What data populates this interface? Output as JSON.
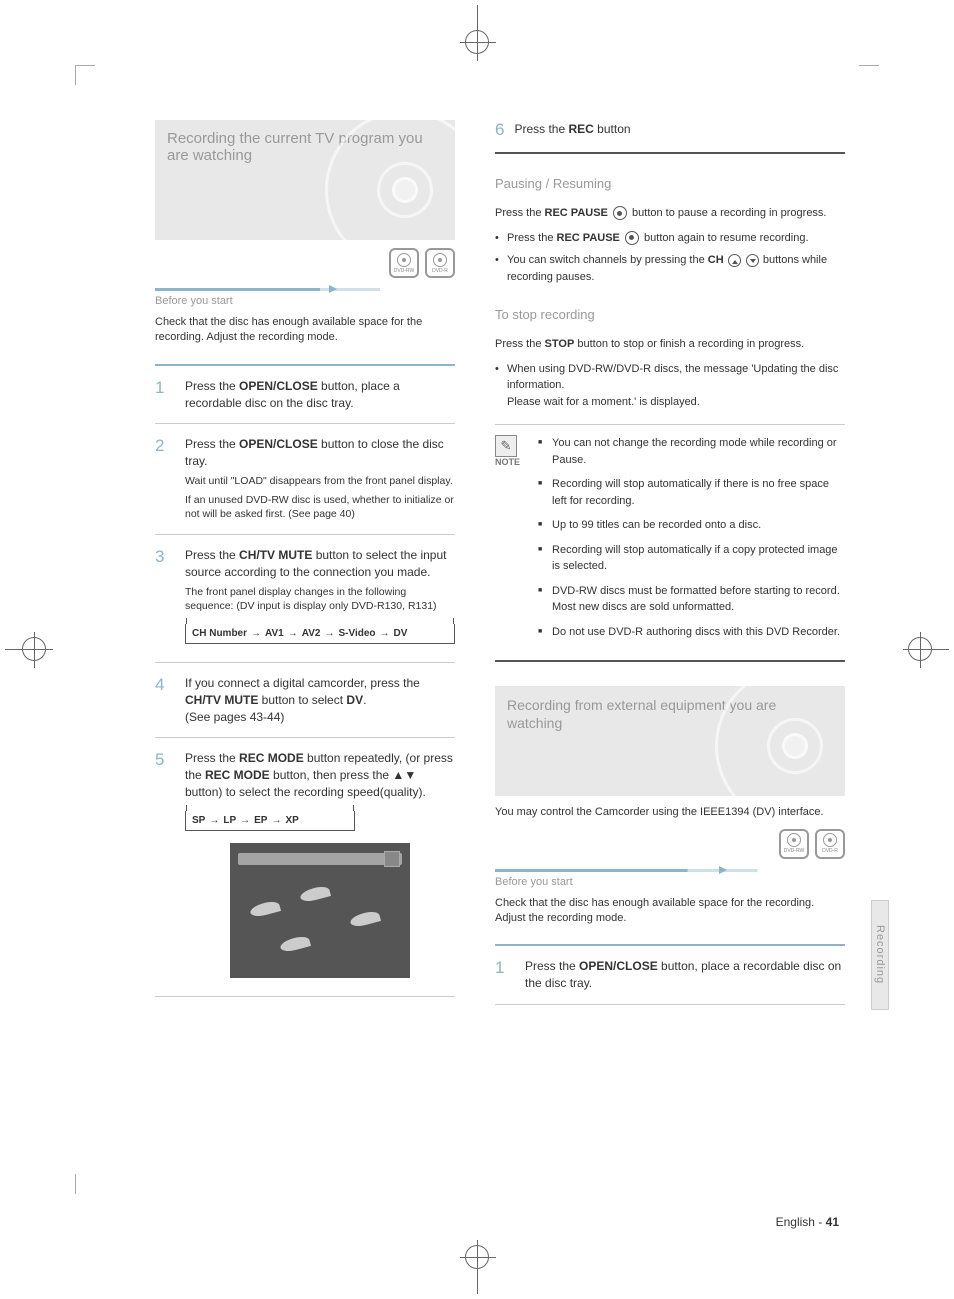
{
  "left": {
    "hero_title": "Recording the current TV program you are watching",
    "badges": [
      "DVD-RW",
      "DVD-R"
    ],
    "before_label": "Before you start",
    "intro": "Check that the disc has enough available space for the recording. Adjust the recording mode.",
    "steps": {
      "s1": {
        "n": "1",
        "t1": "Press the ",
        "kw": "OPEN/CLOSE",
        "t2": " button, place a recordable disc on the disc tray."
      },
      "s2": {
        "n": "2",
        "t1": "Press the ",
        "kw": "OPEN/CLOSE",
        "t2": " button to close the disc tray.",
        "small1": "Wait until \"LOAD\" disappears from the front panel display.",
        "small2": "If an unused DVD-RW disc is used, whether to initialize or not will be asked first. (See page 40)"
      },
      "s3": {
        "n": "3",
        "t1": "Press the ",
        "kw": "CH/TV MUTE",
        "t2": " button to select the input source according to the connection you made.",
        "small": "The front panel display changes in the following sequence: (DV input is display only DVD-R130, R131)",
        "seq": [
          "CH Number",
          "AV1",
          "AV2",
          "S-Video",
          "DV"
        ]
      },
      "s4": {
        "n": "4",
        "t1": "If you connect a digital camcorder, press the ",
        "kw": "CH/TV MUTE",
        "t2": " button to select ",
        "dv": "DV",
        "t3": ".",
        "ref": "(See pages 43-44)"
      },
      "s5": {
        "n": "5",
        "t1": "Press the ",
        "kw1": "REC MODE",
        "t2": " button repeatedly, (or press the ",
        "kw2": "REC MODE",
        "t3": " button, then press the ▲▼ button) to select the recording speed(quality).",
        "seq": [
          "SP",
          "LP",
          "EP",
          "XP"
        ]
      }
    }
  },
  "right": {
    "s6": {
      "n": "6",
      "t1": "Press the ",
      "kw": "REC",
      "t2": " button"
    },
    "sub1_title": "Pausing / Resuming",
    "pause": {
      "p1a": "Press the ",
      "p1b": "REC PAUSE",
      "p1c": " button to pause a recording in progress.",
      "b1a": "Press the ",
      "b1b": "REC PAUSE",
      "b1c": " button again to resume recording.",
      "b2a": "You can switch channels by pressing the ",
      "b2b": "CH",
      "b2c": " buttons while recording pauses."
    },
    "sub2_title": "To stop recording",
    "stop": {
      "p1a": "Press the ",
      "p1b": "STOP",
      "p1c": " button to stop or finish a recording in progress.",
      "b1": "When using DVD-RW/DVD-R discs, the message 'Updating the disc information.\nPlease wait for a moment.' is displayed."
    },
    "note_label": "NOTE",
    "notes": [
      "You can not change the recording mode while recording or Pause.",
      "Recording will stop automatically if there is no free space left for recording.",
      "Up to 99 titles can be recorded onto a disc.",
      "Recording will stop automatically if a copy protected image is selected.",
      "DVD-RW discs must be formatted before starting to record. Most new discs are sold unformatted.",
      "Do not use DVD-R authoring discs with this DVD Recorder."
    ],
    "hero2_title": "Recording from external equipment you are watching",
    "badges2": [
      "DVD-RW",
      "DVD-R"
    ],
    "before_label2": "Before you start",
    "intro2": "Check that the disc has enough available space for the recording. Adjust the recording mode.",
    "r_s1": {
      "n": "1",
      "t1": "Press the ",
      "kw": "OPEN/CLOSE",
      "t2": " button, place a recordable disc on the disc tray."
    }
  },
  "footer": {
    "lang": "English - ",
    "page": "41"
  },
  "side_tab": "Recording"
}
